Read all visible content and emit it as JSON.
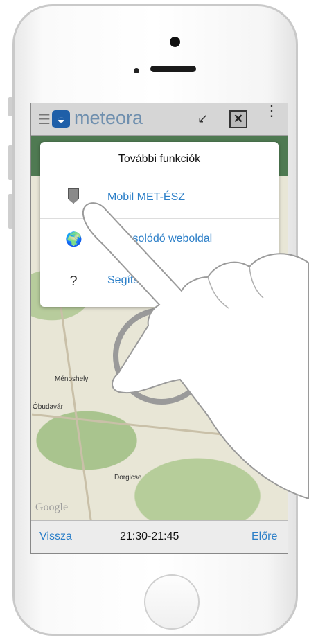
{
  "app": {
    "brand": "meteora",
    "logo_glyph": "◒",
    "menu_glyph": "☰",
    "collapse_glyph": "↙",
    "close_glyph": "✕",
    "more_glyph": "⋮",
    "accent_color": "#2c7fc8",
    "logo_color": "#1f5fa8"
  },
  "dropdown": {
    "title": "További funkciók",
    "items": [
      {
        "label": "Mobil MET-ÉSZ",
        "icon": "pin-icon"
      },
      {
        "label": "Kapcsolódó weboldal",
        "icon": "globe-icon",
        "glyph": "🌍"
      },
      {
        "label": "Segítség",
        "icon": "help-icon",
        "glyph": "?"
      }
    ]
  },
  "map": {
    "labels": [
      "Ménoshely",
      "Óbudavár",
      "Dorgicse"
    ],
    "attribution": "Google"
  },
  "bottombar": {
    "back": "Vissza",
    "time": "21:30-21:45",
    "forward": "Előre"
  }
}
